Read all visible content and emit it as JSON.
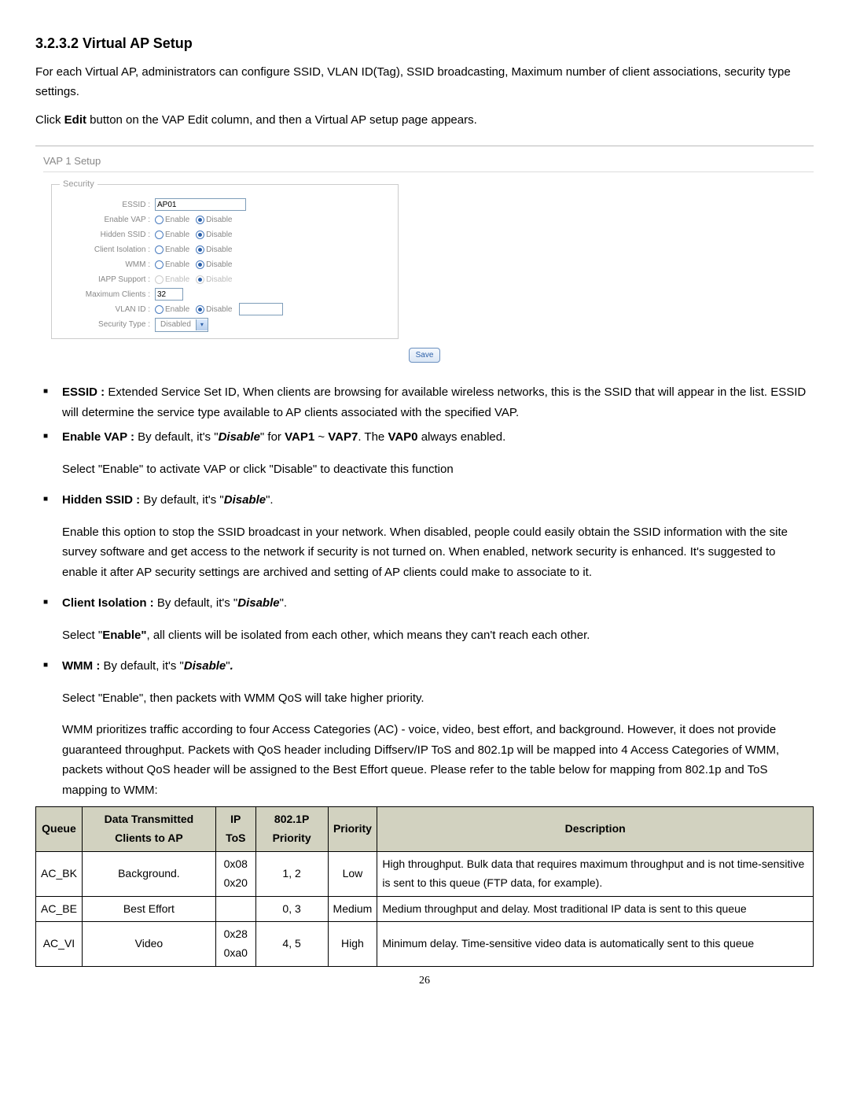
{
  "heading": "3.2.3.2 Virtual AP Setup",
  "intro1": "For each Virtual AP, administrators can configure SSID, VLAN ID(Tag), SSID broadcasting, Maximum number of client associations, security type settings.",
  "intro2_a": "Click ",
  "intro2_b": "Edit",
  "intro2_c": " button on the VAP Edit column, and then a Virtual AP setup page appears.",
  "shot": {
    "title": "VAP 1 Setup",
    "legend": "Security",
    "labels": {
      "essid": "ESSID :",
      "enable_vap": "Enable VAP :",
      "hidden_ssid": "Hidden SSID :",
      "client_iso": "Client Isolation :",
      "wmm": "WMM :",
      "iapp": "IAPP Support :",
      "max_clients": "Maximum Clients :",
      "vlan_id": "VLAN ID :",
      "sec_type": "Security Type :"
    },
    "values": {
      "essid": "AP01",
      "max_clients": "32",
      "sec_type": "Disabled"
    },
    "opt_enable": "Enable",
    "opt_disable": "Disable",
    "save": "Save"
  },
  "bullets": {
    "essid": {
      "label": "ESSID :",
      "text": " Extended  Service Set ID, When clients are browsing for available wireless networks, this is the SSID that will appear in the list. ESSID will determine the service type available to AP clients associated with the specified VAP."
    },
    "enable_vap": {
      "label": "Enable VAP :",
      "t1": "  By default, it's \"",
      "em": "Disable",
      "t2": "\" for ",
      "v1": "VAP1",
      "tilde": " ~ ",
      "v7": "VAP7",
      "t3": ". The ",
      "v0": "VAP0",
      "t4": " always enabled.",
      "body": "Select \"Enable\" to activate VAP or click \"Disable\" to deactivate this function"
    },
    "hidden_ssid": {
      "label": "Hidden SSID :",
      "t1": " By default, it's \"",
      "em": "Disable",
      "t2": "\".",
      "body": "Enable this option to stop the SSID broadcast in your network. When disabled, people could easily obtain the SSID information with the site survey software and get access to the network if security is not turned on. When enabled, network security is enhanced. It's suggested to enable it after AP security settings are archived and setting of AP clients could make to associate to it."
    },
    "client_iso": {
      "label": "Client Isolation :",
      "t1": " By default, it's \"",
      "em": "Disable",
      "t2": "\".",
      "body_a": "Select \"",
      "body_b": "Enable\"",
      "body_c": ", all clients will be isolated from each other, which means they can't reach each other."
    },
    "wmm": {
      "label": "WMM :",
      "t1": " By default, it's \"",
      "em": "Disable",
      "t2": "\"",
      "dot": ".",
      "body1": "Select \"Enable\", then packets with WMM QoS will take higher priority.",
      "body2": "WMM prioritizes traffic according to four Access Categories (AC) - voice, video, best effort, and background. However, it does not provide guaranteed throughput. Packets with QoS header including Diffserv/IP ToS and 802.1p will be mapped into 4 Access Categories of WMM, packets without QoS header will be assigned to the Best Effort queue. Please refer to the table below for mapping from 802.1p and ToS mapping to WMM:"
    }
  },
  "table": {
    "headers": {
      "queue": "Queue",
      "data": "Data Transmitted Clients to AP",
      "tos": "IP ToS",
      "p8021": "802.1P Priority",
      "priority": "Priority",
      "desc": "Description"
    },
    "rows": [
      {
        "queue": "AC_BK",
        "data": "Background.",
        "tos": "0x08 0x20",
        "p8021": "1, 2",
        "priority": "Low",
        "desc": "High throughput. Bulk data that requires maximum throughput and is not time-sensitive is sent to this queue (FTP data, for example)."
      },
      {
        "queue": "AC_BE",
        "data": "Best Effort",
        "tos": "",
        "p8021": "0, 3",
        "priority": "Medium",
        "desc": "Medium throughput and delay. Most traditional IP data is sent to this queue"
      },
      {
        "queue": "AC_VI",
        "data": "Video",
        "tos": "0x28 0xa0",
        "p8021": "4, 5",
        "priority": "High",
        "desc": "Minimum delay. Time-sensitive video data is automatically sent to this queue"
      }
    ]
  },
  "page_number": "26"
}
